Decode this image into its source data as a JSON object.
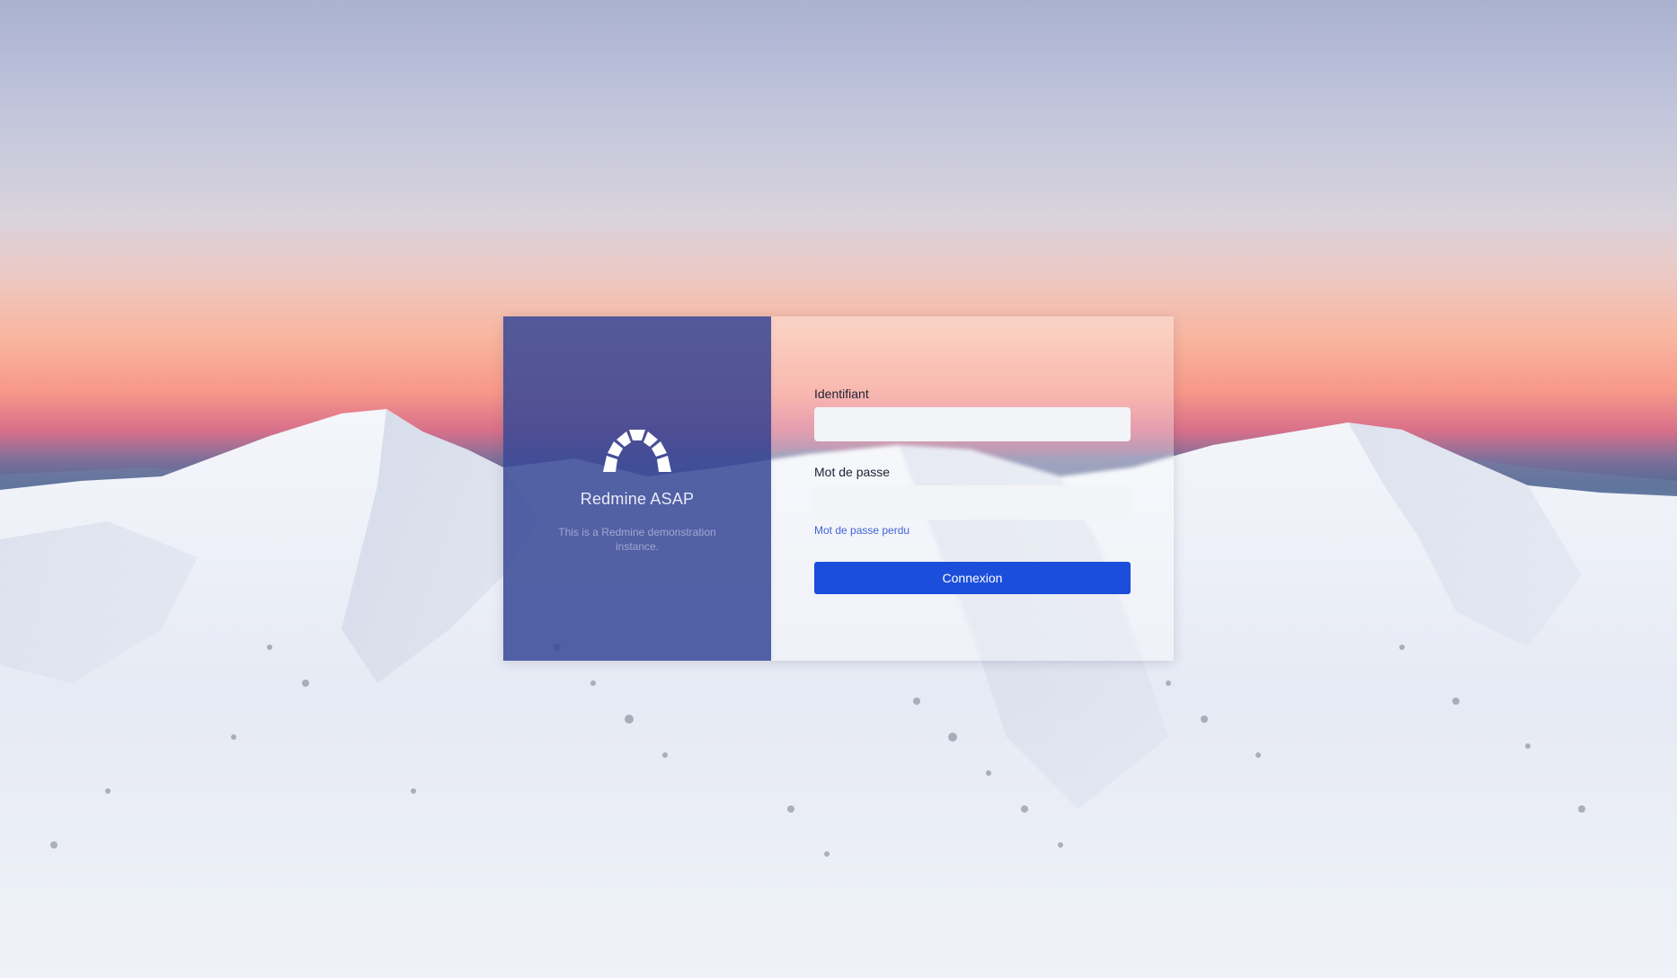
{
  "brand": {
    "logo_icon": "redmine-arch-icon",
    "name": "Redmine ASAP",
    "description": "This is a Redmine demonstration instance."
  },
  "login_form": {
    "username_label": "Identifiant",
    "username_value": "",
    "password_label": "Mot de passe",
    "password_value": "",
    "lost_password_link": "Mot de passe perdu",
    "submit_label": "Connexion"
  },
  "colors": {
    "brand_panel": "#384896",
    "accent_button": "#1b4fdb",
    "link": "#3e63d8"
  }
}
